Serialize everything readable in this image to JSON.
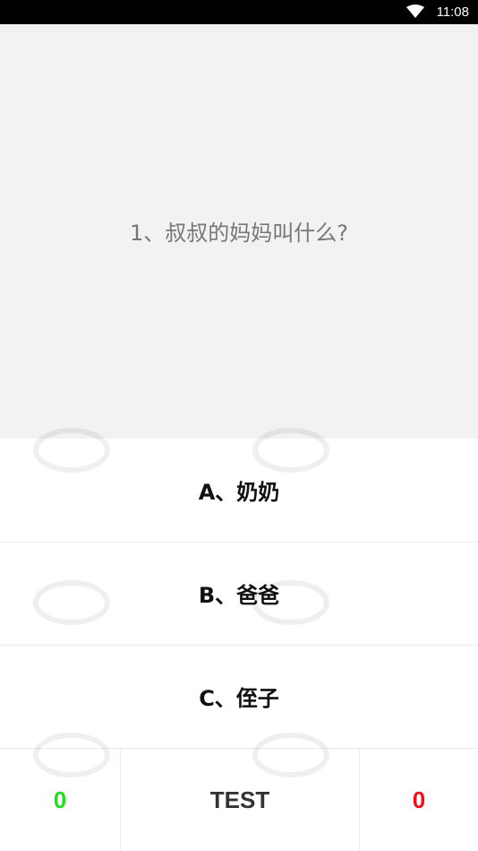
{
  "status_bar": {
    "time": "11:08",
    "wifi_icon": "wifi-icon"
  },
  "question": {
    "text": "1、叔叔的妈妈叫什么?"
  },
  "options": [
    {
      "label": "A、奶奶"
    },
    {
      "label": "B、爸爸"
    },
    {
      "label": "C、侄子"
    }
  ],
  "bottom_bar": {
    "correct_count": "0",
    "test_label": "TEST",
    "wrong_count": "0"
  },
  "colors": {
    "correct": "#22dd22",
    "wrong": "#ee1111",
    "question_bg": "#f2f2f2"
  }
}
